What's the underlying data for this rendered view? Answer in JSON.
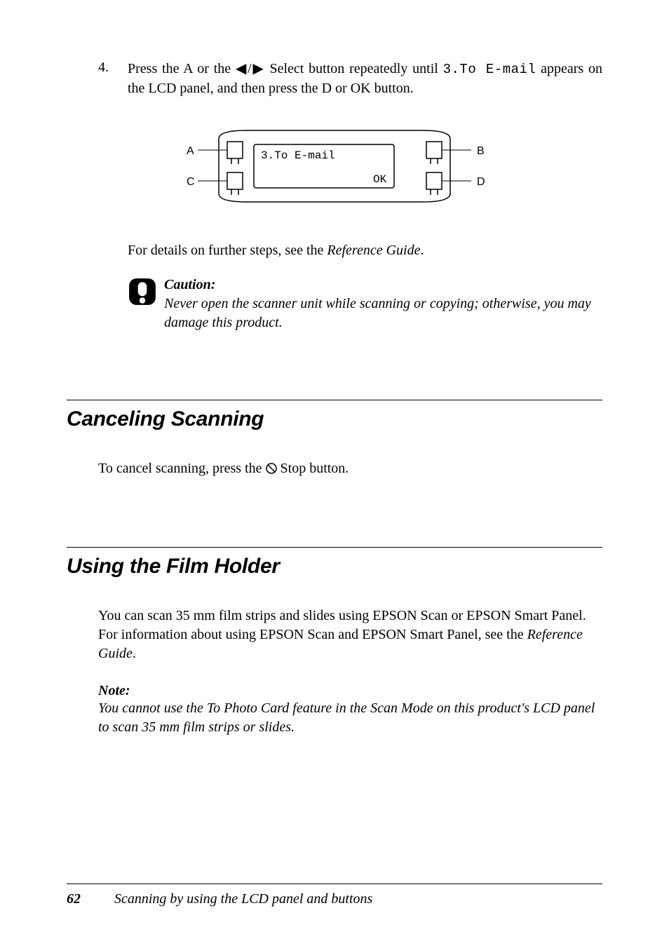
{
  "step": {
    "num": "4.",
    "text_before_mono": "Press the A or the ",
    "triangles": "◀/▶",
    "text_mid": " Select button repeatedly until ",
    "mono": "3.To E-mail",
    "text_after": "appears on the LCD panel, and then press the D or OK button."
  },
  "diagram": {
    "labels": {
      "a": "A",
      "b": "B",
      "c": "C",
      "d": "D"
    },
    "lcd_line1": "3.To E-mail",
    "lcd_line2": "OK"
  },
  "detail": {
    "prefix": "For details on further steps, see the ",
    "ref": "Reference Guide",
    "suffix": "."
  },
  "caution": {
    "label": "Caution:",
    "body": "Never open the scanner unit while scanning or copying; otherwise, you may damage this product."
  },
  "section1": {
    "heading": "Canceling Scanning",
    "para_prefix": "To cancel scanning, press the ",
    "para_suffix": " Stop button."
  },
  "section2": {
    "heading": "Using the Film Holder",
    "para_prefix": "You can scan 35 mm film strips and slides using EPSON Scan or EPSON Smart Panel. For information about using EPSON Scan and EPSON Smart Panel, see the ",
    "para_ref": "Reference Guide",
    "para_suffix": ".",
    "note_label": "Note:",
    "note_body": "You cannot use the To Photo Card feature in the Scan Mode on this product's LCD panel to scan 35 mm film strips or slides."
  },
  "footer": {
    "page": "62",
    "title": "Scanning by using the LCD panel and buttons"
  }
}
